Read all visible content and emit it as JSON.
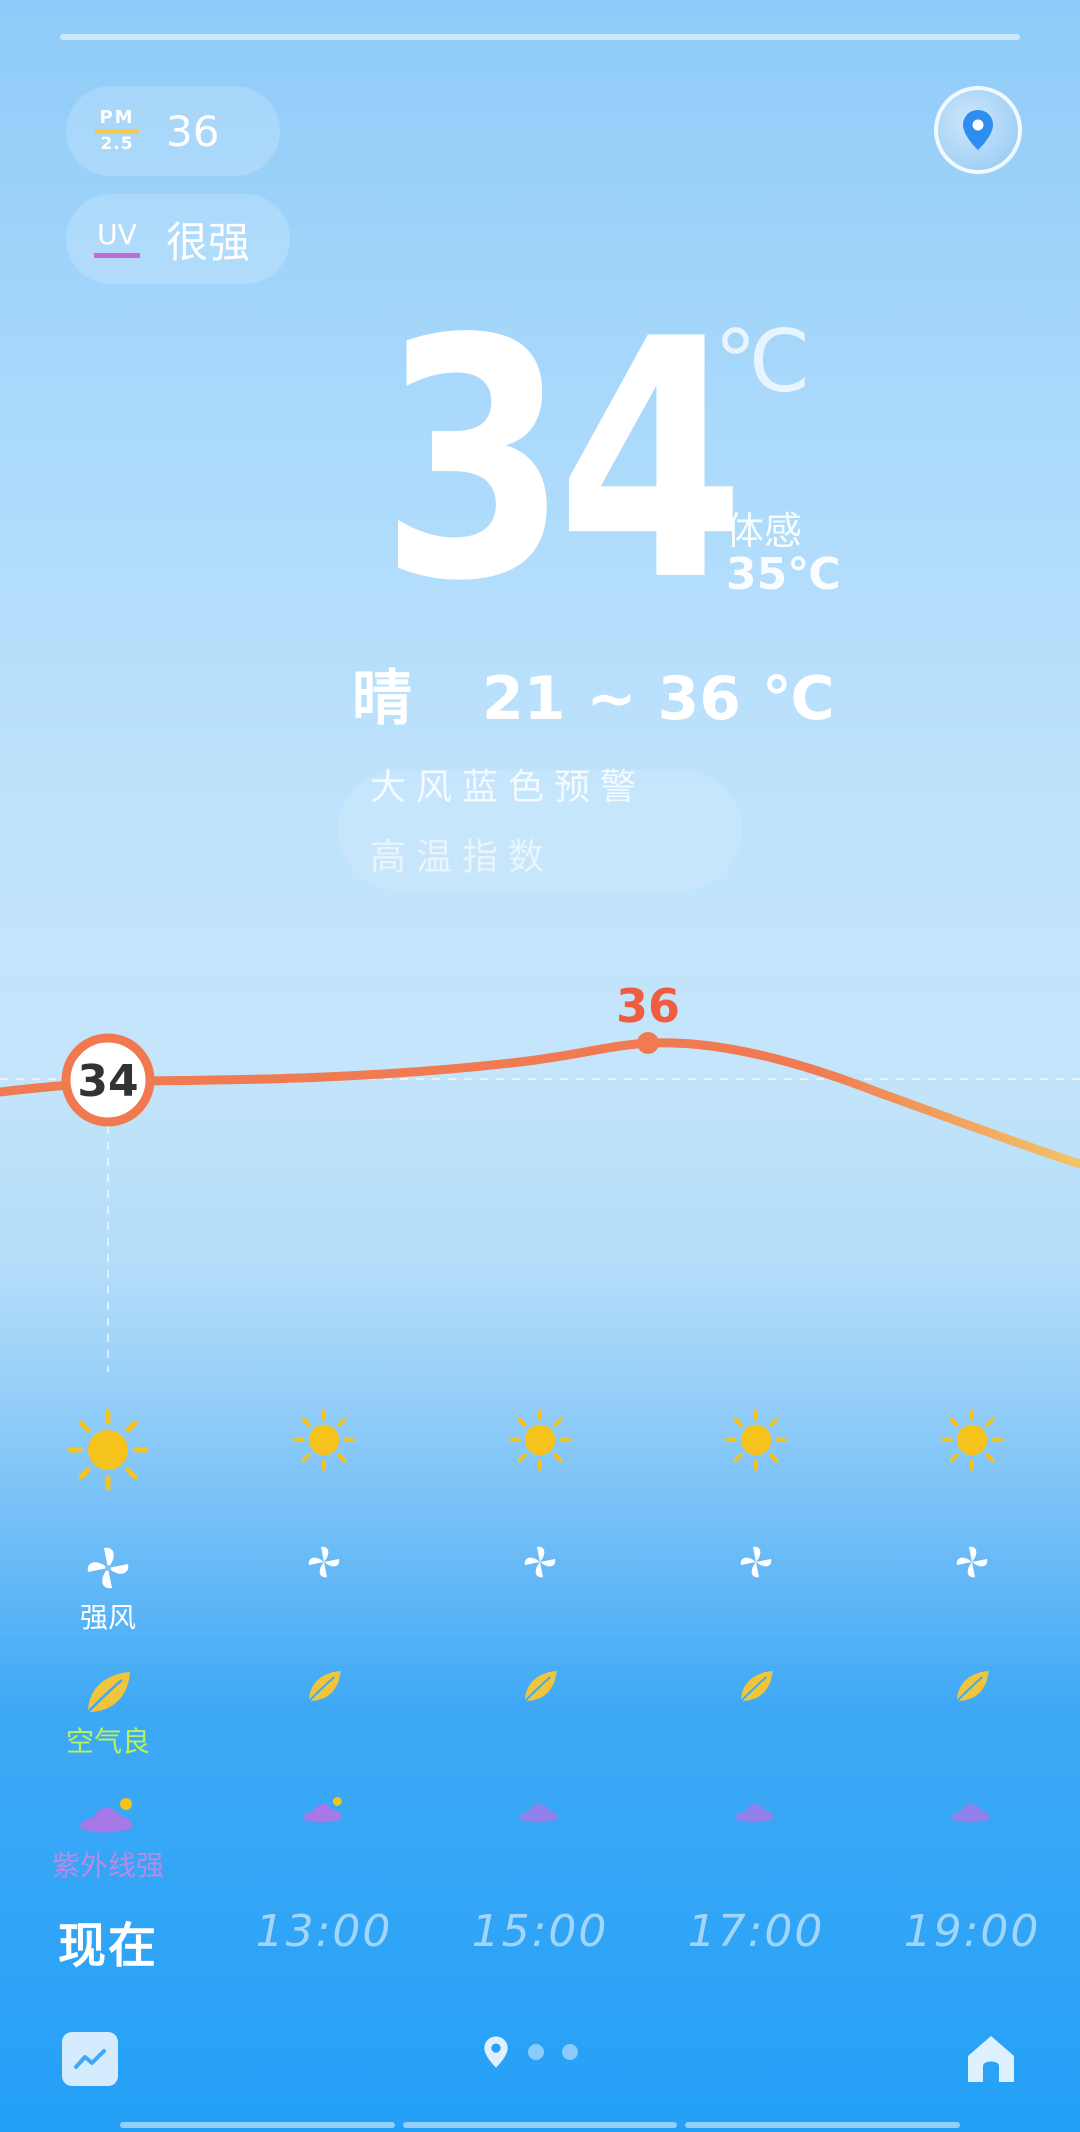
{
  "status": {
    "pm25_label_top": "PM",
    "pm25_label_bottom": "2.5",
    "pm25_value": "36",
    "uv_label": "UV",
    "uv_value": "很强"
  },
  "current": {
    "temperature": "34",
    "unit": "℃",
    "feels_like_label": "体感",
    "feels_like_value": "35℃",
    "condition": "晴",
    "range": "21 ~ 36 ℃"
  },
  "faded_banner": {
    "line1": "大风蓝色预警",
    "line2": "高温指数"
  },
  "curve": {
    "current_value": "34",
    "peak_value": "36",
    "colors": {
      "line": "#f07a52",
      "tail": "#f3c46a",
      "badge_ring": "#f2784f"
    }
  },
  "hourly": [
    {
      "time": "现在",
      "wind_label": "强风",
      "air_label": "空气良",
      "uv_label": "紫外线强"
    },
    {
      "time": "13:00"
    },
    {
      "time": "15:00"
    },
    {
      "time": "17:00"
    },
    {
      "time": "19:00"
    }
  ],
  "icons": {
    "weather": "sun-icon",
    "wind": "pinwheel-icon",
    "air": "leaf-icon",
    "uv": "hat-icon",
    "location": "location-pin-icon",
    "trend": "trend-chart-icon",
    "home": "home-icon"
  },
  "colors": {
    "sun": "#f6c21c",
    "leaf": "#f0c53a",
    "air_label": "#b8f25b",
    "uv_hat": "#a678e8",
    "uv_label": "#b88ae6"
  }
}
